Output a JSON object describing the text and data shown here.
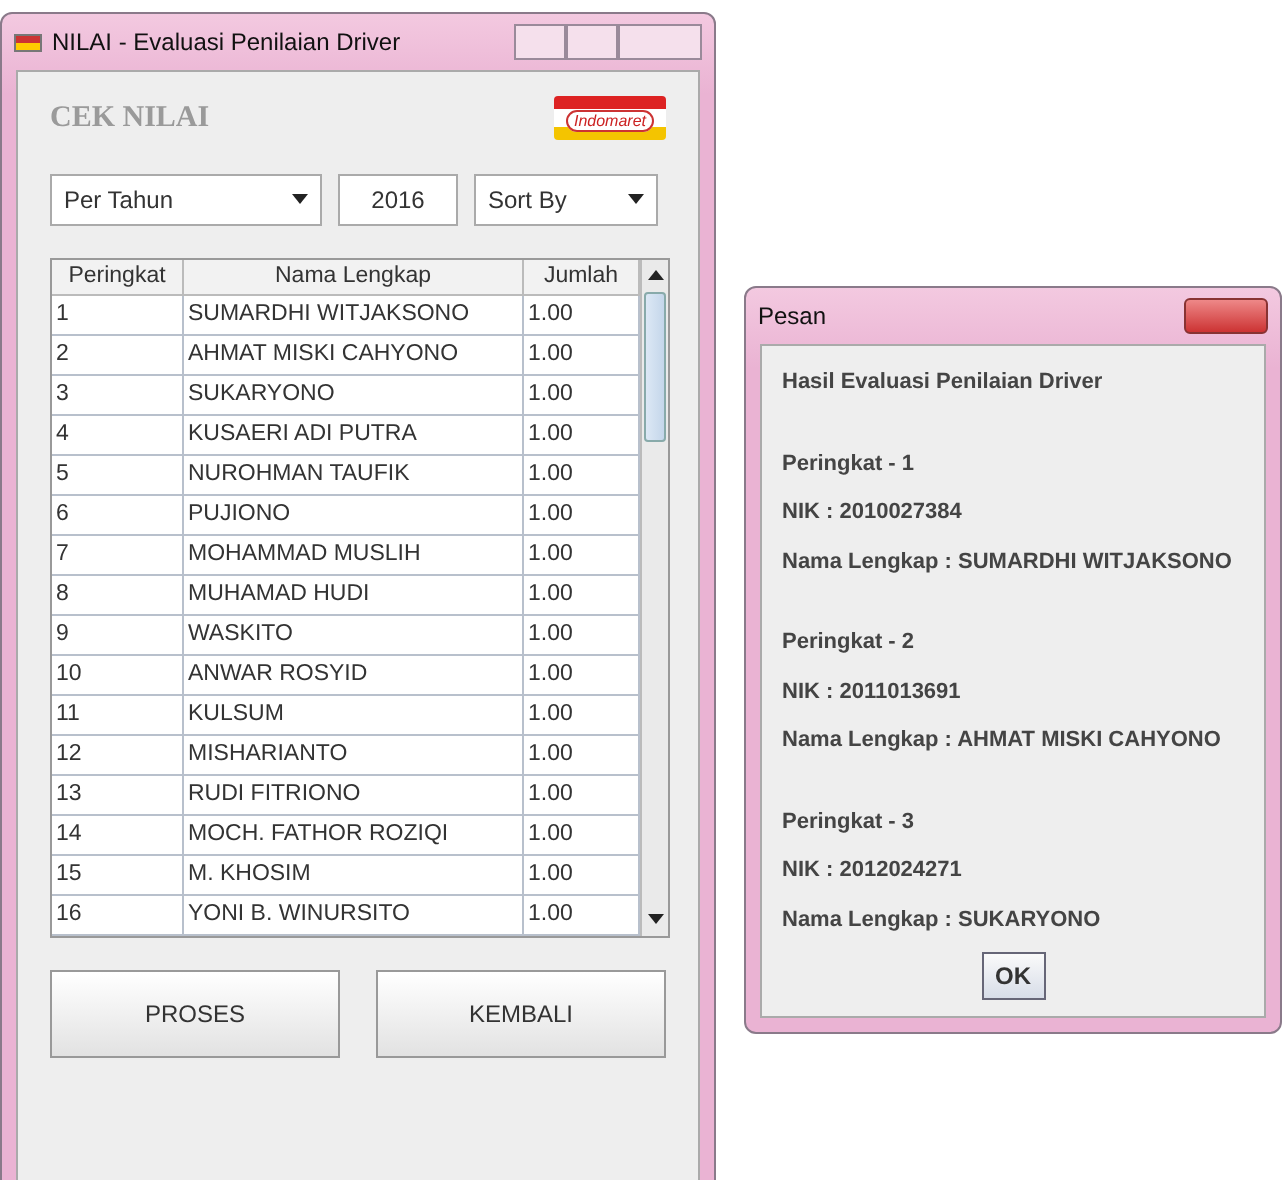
{
  "main_window": {
    "title": "NILAI - Evaluasi Penilaian Driver",
    "heading": "CEK NILAI",
    "logo": "Indomaret",
    "period_select": {
      "value": "Per Tahun"
    },
    "year_field": {
      "value": "2016"
    },
    "sort_select": {
      "value": "Sort By"
    },
    "table": {
      "columns": [
        "Peringkat",
        "Nama Lengkap",
        "Jumlah"
      ],
      "rows": [
        [
          "1",
          "SUMARDHI WITJAKSONO",
          "1.00"
        ],
        [
          "2",
          "AHMAT MISKI CAHYONO",
          "1.00"
        ],
        [
          "3",
          "SUKARYONO",
          "1.00"
        ],
        [
          "4",
          "KUSAERI ADI PUTRA",
          "1.00"
        ],
        [
          "5",
          "NUROHMAN TAUFIK",
          "1.00"
        ],
        [
          "6",
          "PUJIONO",
          "1.00"
        ],
        [
          "7",
          "MOHAMMAD MUSLIH",
          "1.00"
        ],
        [
          "8",
          "MUHAMAD HUDI",
          "1.00"
        ],
        [
          "9",
          "WASKITO",
          "1.00"
        ],
        [
          "10",
          "ANWAR ROSYID",
          "1.00"
        ],
        [
          "11",
          "KULSUM",
          "1.00"
        ],
        [
          "12",
          "MISHARIANTO",
          "1.00"
        ],
        [
          "13",
          "RUDI FITRIONO",
          "1.00"
        ],
        [
          "14",
          "MOCH. FATHOR ROZIQI",
          "1.00"
        ],
        [
          "15",
          "M. KHOSIM",
          "1.00"
        ],
        [
          "16",
          "YONI B. WINURSITO",
          "1.00"
        ]
      ]
    },
    "buttons": [
      "PROSES",
      "KEMBALI"
    ]
  },
  "dialog": {
    "title": "Pesan",
    "heading": "Hasil Evaluasi Penilaian Driver",
    "results": [
      {
        "rank": "Peringkat - 1",
        "nik": "NIK : 2010027384",
        "name": "Nama Lengkap : SUMARDHI WITJAKSONO"
      },
      {
        "rank": "Peringkat - 2",
        "nik": "NIK : 2011013691",
        "name": "Nama Lengkap : AHMAT MISKI CAHYONO"
      },
      {
        "rank": "Peringkat - 3",
        "nik": "NIK : 2012024271",
        "name": "Nama Lengkap : SUKARYONO"
      }
    ],
    "button": "OK"
  }
}
